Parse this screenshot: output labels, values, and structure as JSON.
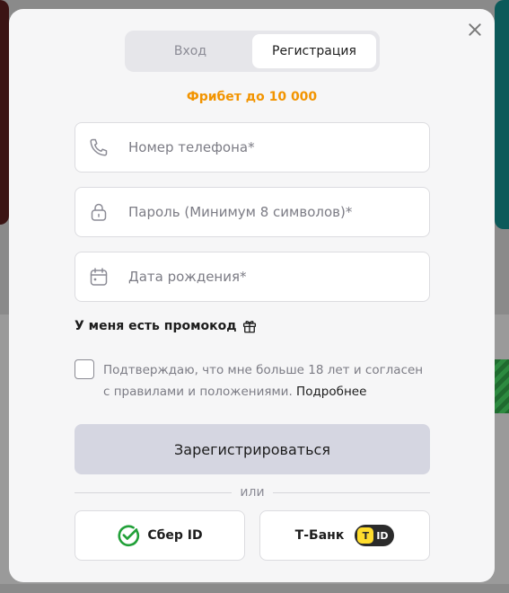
{
  "tabs": [
    {
      "label": "Вход",
      "active": false
    },
    {
      "label": "Регистрация",
      "active": true
    }
  ],
  "promo_banner": "Фрибет до 10 000",
  "fields": {
    "phone": {
      "placeholder": "Номер телефона*",
      "value": "",
      "icon": "phone-icon"
    },
    "password": {
      "placeholder": "Пароль (Минимум 8 символов)*",
      "value": "",
      "icon": "lock-icon"
    },
    "birthdate": {
      "placeholder": "Дата рождения*",
      "value": "",
      "icon": "calendar-icon"
    }
  },
  "promo_code_label": "У меня есть промокод",
  "agreement": {
    "text": "Подтверждаю, что мне больше 18 лет и согласен с правилами и положениями.",
    "link": "Подробнее",
    "checked": false
  },
  "submit_label": "Зарегистрироваться",
  "divider_label": "или",
  "sso": {
    "sber": "Сбер ID",
    "tbank": "Т-Банк",
    "tbank_badge_logo": "T",
    "tbank_badge_text": "ID"
  },
  "colors": {
    "accent_orange": "#f29400",
    "submit_bg": "#d5d6e1",
    "sber_green": "#21a038",
    "tbank_yellow": "#ffdd2d"
  }
}
